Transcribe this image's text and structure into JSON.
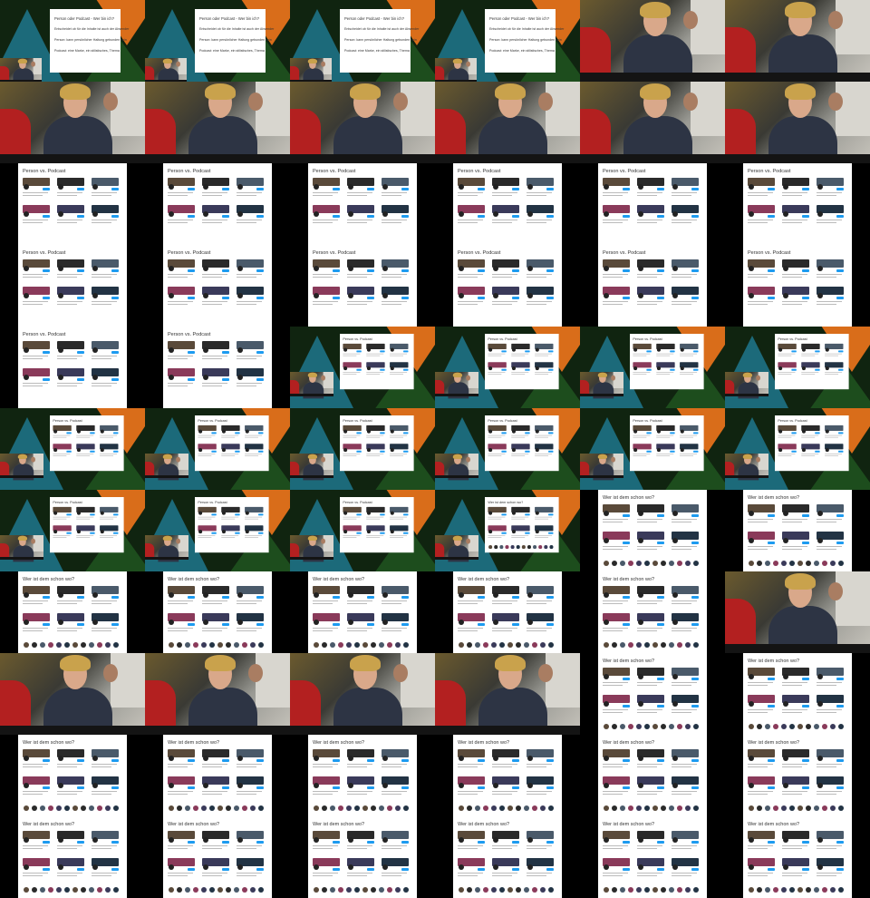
{
  "slides": {
    "person_oder_podcast": "Person oder Podcast - Wer bin ich?",
    "p_line1": "Entscheidet ob für die Inhalte ist auch der Absender",
    "p_line2": "Person: kann persönlicher Haltung gebunden sein",
    "p_line3": "Podcast: eine Marke, ein stilistisches, Thema",
    "person_vs_podcast": "Person vs. Podcast",
    "wer_ist_dem_schon_wo": "Wer ist dem schon wo?"
  },
  "colors": {
    "twitter_blue": "#1d9bf0",
    "slide_bg": "#ffffff",
    "frame_bg": "#000000",
    "backdrop_green": "#102410",
    "accent_orange": "#d96d1a",
    "accent_teal": "#1c6a7a",
    "shirt_red": "#b32020"
  }
}
